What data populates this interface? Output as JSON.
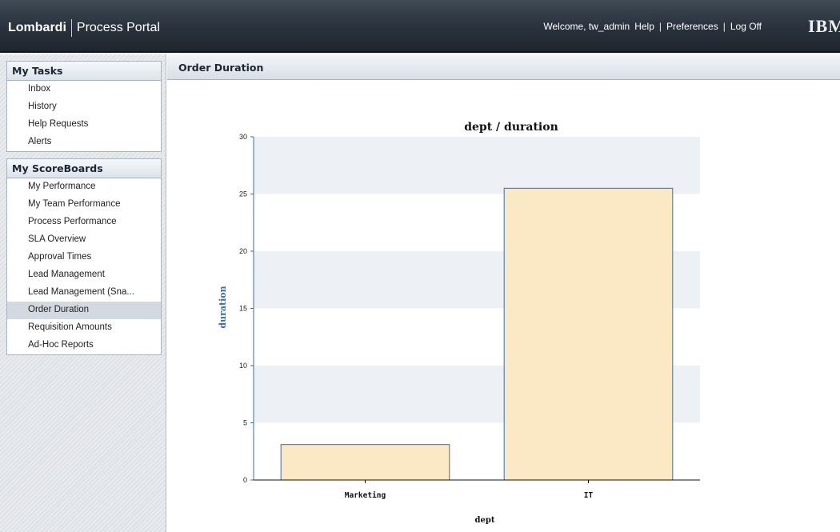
{
  "header": {
    "brand": "Lombardi",
    "product": "Process Portal",
    "welcome": "Welcome, tw_admin",
    "links": [
      "Help",
      "Preferences",
      "Log Off"
    ],
    "separator": "|",
    "vendor_logo": "IBM"
  },
  "sidebar": {
    "tasks_title": "My Tasks",
    "tasks": [
      "Inbox",
      "History",
      "Help Requests",
      "Alerts"
    ],
    "scoreboards_title": "My ScoreBoards",
    "scoreboards": [
      "My Performance",
      "My Team Performance",
      "Process Performance",
      "SLA Overview",
      "Approval Times",
      "Lead Management",
      "Lead Management (Sna...",
      "Order Duration",
      "Requisition Amounts",
      "Ad-Hoc Reports"
    ],
    "active_scoreboard": "Order Duration"
  },
  "main": {
    "title": "Order Duration"
  },
  "colors": {
    "bar_fill": "#fbe9c6",
    "bar_stroke": "#3a6ea5",
    "axis_text": "#3a6ea5",
    "band": "#edf0f4"
  },
  "chart_data": {
    "type": "bar",
    "title": "dept / duration",
    "xlabel": "dept",
    "ylabel": "duration",
    "categories": [
      "Marketing",
      "IT"
    ],
    "values": [
      3.1,
      25.5
    ],
    "ylim": [
      0,
      30
    ],
    "yticks": [
      0,
      5,
      10,
      15,
      20,
      25,
      30
    ],
    "grid": "alternating horizontal bands",
    "legend": "none"
  }
}
